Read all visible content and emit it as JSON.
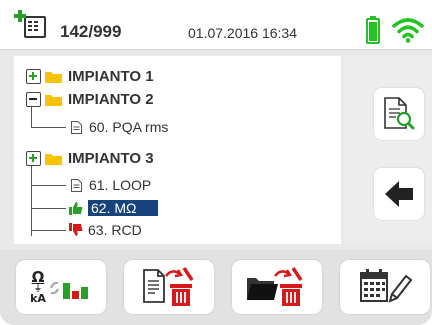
{
  "header": {
    "counter": "142/999",
    "datetime": "01.07.2016 16:34"
  },
  "tree": {
    "groups": [
      {
        "label": "IMPIANTO 1",
        "expanded": false
      },
      {
        "label": "IMPIANTO 2",
        "expanded": true,
        "children": [
          {
            "label": "60. PQA rms",
            "type": "document"
          }
        ]
      },
      {
        "label": "IMPIANTO 3",
        "expanded": true,
        "children": [
          {
            "label": "61. LOOP",
            "type": "document"
          },
          {
            "label": "62. MΩ",
            "type": "pass",
            "selected": true
          },
          {
            "label": "63. RCD",
            "type": "fail"
          }
        ]
      }
    ]
  },
  "toolbar": {
    "range_units": [
      "Ω",
      "kA"
    ]
  },
  "icons": {
    "counter": "memory-card-plus-icon",
    "battery": "battery-icon",
    "wifi": "wifi-icon",
    "zoom": "document-magnifier-icon",
    "back": "back-arrow-icon",
    "range": "measure-range-icon",
    "delete_doc": "delete-document-icon",
    "delete_folder": "delete-folder-icon",
    "calendar": "calendar-edit-icon"
  },
  "colors": {
    "plus_green": "#2a9d2a",
    "folder_yellow": "#f5c300",
    "selection_blue": "#16447a",
    "wifi_green": "#22c322",
    "delete_red": "#d41a1a"
  }
}
